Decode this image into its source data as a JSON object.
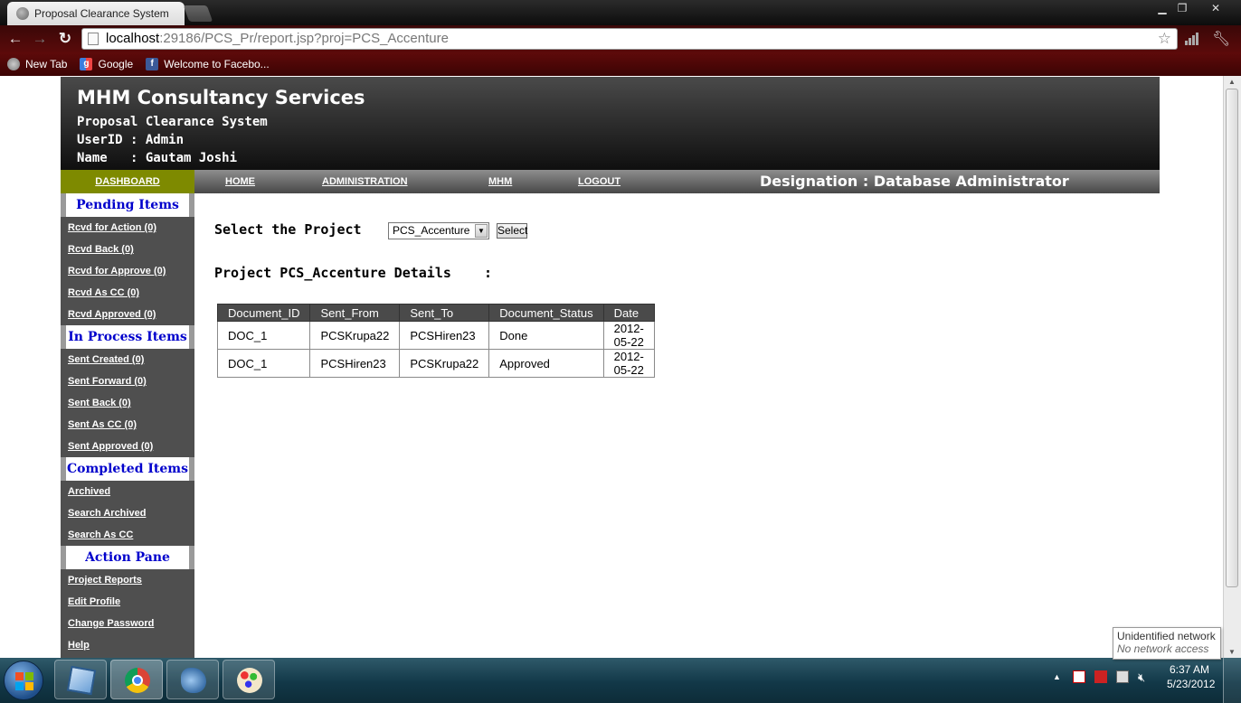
{
  "browser": {
    "tab_title": "Proposal Clearance System",
    "url_host": "localhost",
    "url_rest": ":29186/PCS_Pr/report.jsp?proj=PCS_Accenture",
    "bookmarks": [
      {
        "label": "New Tab",
        "icon": "newtab-icon"
      },
      {
        "label": "Google",
        "icon": "google-icon"
      },
      {
        "label": "Welcome to Facebo...",
        "icon": "facebook-icon"
      }
    ],
    "window_controls": {
      "minimize": "▁",
      "maximize": "❐",
      "close": "✕"
    }
  },
  "header": {
    "company": "MHM Consultancy Services",
    "system_title": "Proposal Clearance System",
    "userid_line": "UserID : Admin",
    "name_line": "Name   : Gautam Joshi"
  },
  "nav": {
    "dashboard": "DASHBOARD",
    "home": "HOME",
    "administration": "ADMINISTRATION",
    "mhm": "MHM",
    "logout": "LOGOUT",
    "designation": "Designation : Database Administrator"
  },
  "sidebar": {
    "sections": [
      {
        "title": "Pending Items",
        "items": [
          "Rcvd for Action (0)",
          "Rcvd Back (0)",
          "Rcvd for Approve (0)",
          "Rcvd As CC (0)",
          "Rcvd Approved (0)"
        ]
      },
      {
        "title": "In Process Items",
        "items": [
          "Sent Created (0)",
          "Sent Forward (0)",
          "Sent Back (0)",
          "Sent As CC (0)",
          "Sent Approved (0)"
        ]
      },
      {
        "title": "Completed Items",
        "items": [
          "Archived",
          "Search Archived",
          "Search As CC"
        ]
      },
      {
        "title": "Action Pane",
        "items": [
          "Project Reports",
          "Edit Profile",
          "Change Password",
          "Help"
        ]
      }
    ]
  },
  "main": {
    "select_label": "Select the Project    :",
    "selected_project": "PCS_Accenture",
    "select_button": "Select",
    "details_label": "Project PCS_Accenture Details    :",
    "table": {
      "columns": [
        "Document_ID",
        "Sent_From",
        "Sent_To",
        "Document_Status",
        "Date"
      ],
      "rows": [
        [
          "DOC_1",
          "PCSKrupa22",
          "PCSHiren23",
          "Done",
          "2012-05-22"
        ],
        [
          "DOC_1",
          "PCSHiren23",
          "PCSKrupa22",
          "Approved",
          "2012-05-22"
        ]
      ]
    }
  },
  "taskbar": {
    "apps": [
      "virtualbox-icon",
      "chrome-icon",
      "dolphin-icon",
      "paint-icon"
    ],
    "time": "6:37 AM",
    "date": "5/23/2012"
  },
  "network_tooltip": {
    "title": "Unidentified network",
    "subtitle": "No network access"
  },
  "colors": {
    "nav_dashboard_bg": "#7e8a00",
    "sidebar_bg": "#4f4f4f",
    "section_head_text": "#0000cc",
    "table_header_bg": "#4a4a4a"
  }
}
